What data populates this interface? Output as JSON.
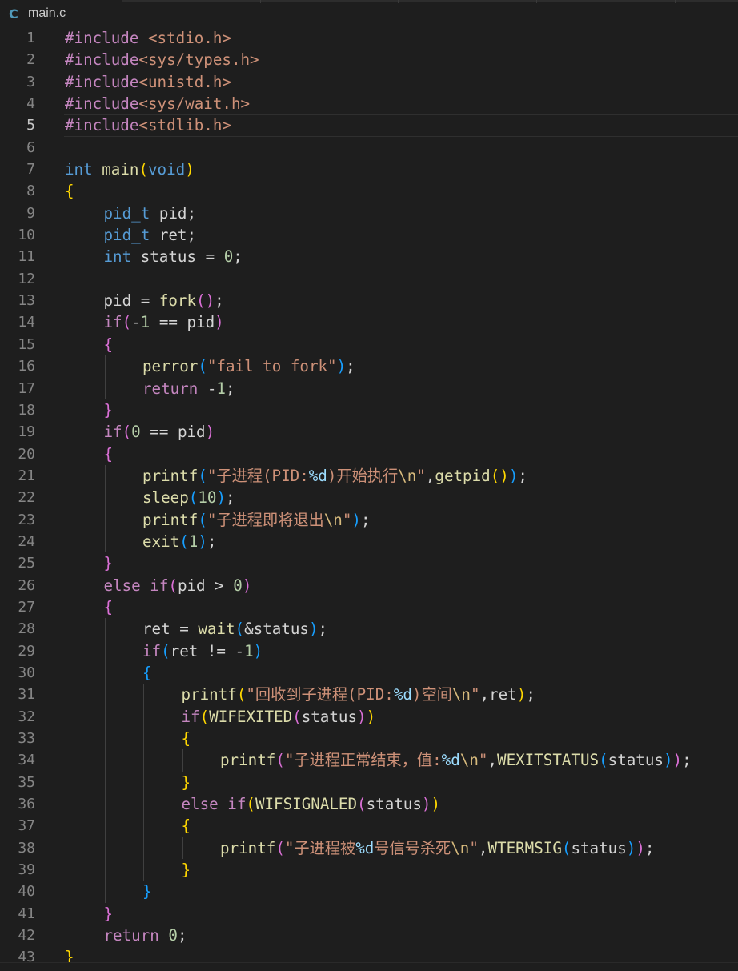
{
  "tab": {
    "icon": "C",
    "icon_name": "c-file-icon",
    "filename": "main.c"
  },
  "colors": {
    "background": "#1e1e1e",
    "preprocessor": "#c586c0",
    "keyword": "#569cd6",
    "control": "#c586c0",
    "function": "#dcdcaa",
    "string": "#ce9178",
    "number": "#b5cea8",
    "bracket_1": "#ffd700",
    "bracket_2": "#da70d6",
    "bracket_3": "#179fff"
  },
  "editor": {
    "current_line": 5,
    "lines": [
      {
        "n": "1",
        "indent": 0,
        "tokens": [
          [
            "pp",
            "#include"
          ],
          [
            "txt",
            " "
          ],
          [
            "inc",
            "<stdio.h>"
          ]
        ]
      },
      {
        "n": "2",
        "indent": 0,
        "tokens": [
          [
            "pp",
            "#include"
          ],
          [
            "inc",
            "<sys/types.h>"
          ]
        ]
      },
      {
        "n": "3",
        "indent": 0,
        "tokens": [
          [
            "pp",
            "#include"
          ],
          [
            "inc",
            "<unistd.h>"
          ]
        ]
      },
      {
        "n": "4",
        "indent": 0,
        "tokens": [
          [
            "pp",
            "#include"
          ],
          [
            "inc",
            "<sys/wait.h>"
          ]
        ]
      },
      {
        "n": "5",
        "indent": 0,
        "tokens": [
          [
            "pp",
            "#include"
          ],
          [
            "inc",
            "<stdlib.h>"
          ]
        ]
      },
      {
        "n": "6",
        "indent": 0,
        "tokens": []
      },
      {
        "n": "7",
        "indent": 0,
        "tokens": [
          [
            "kw",
            "int"
          ],
          [
            "txt",
            " "
          ],
          [
            "fn",
            "main"
          ],
          [
            "b1",
            "("
          ],
          [
            "kw",
            "void"
          ],
          [
            "b1",
            ")"
          ]
        ]
      },
      {
        "n": "8",
        "indent": 0,
        "tokens": [
          [
            "b1",
            "{"
          ]
        ]
      },
      {
        "n": "9",
        "indent": 1,
        "tokens": [
          [
            "kw",
            "pid_t"
          ],
          [
            "txt",
            " pid;"
          ]
        ]
      },
      {
        "n": "10",
        "indent": 1,
        "tokens": [
          [
            "kw",
            "pid_t"
          ],
          [
            "txt",
            " ret;"
          ]
        ]
      },
      {
        "n": "11",
        "indent": 1,
        "tokens": [
          [
            "kw",
            "int"
          ],
          [
            "txt",
            " status = "
          ],
          [
            "num",
            "0"
          ],
          [
            "txt",
            ";"
          ]
        ]
      },
      {
        "n": "12",
        "indent": 1,
        "tokens": []
      },
      {
        "n": "13",
        "indent": 1,
        "tokens": [
          [
            "txt",
            "pid = "
          ],
          [
            "fn",
            "fork"
          ],
          [
            "b2",
            "()"
          ],
          [
            "txt",
            ";"
          ]
        ]
      },
      {
        "n": "14",
        "indent": 1,
        "tokens": [
          [
            "ctl",
            "if"
          ],
          [
            "b2",
            "("
          ],
          [
            "txt",
            "-"
          ],
          [
            "num",
            "1"
          ],
          [
            "txt",
            " == pid"
          ],
          [
            "b2",
            ")"
          ]
        ]
      },
      {
        "n": "15",
        "indent": 1,
        "tokens": [
          [
            "b2",
            "{"
          ]
        ]
      },
      {
        "n": "16",
        "indent": 2,
        "tokens": [
          [
            "fn",
            "perror"
          ],
          [
            "b3",
            "("
          ],
          [
            "str",
            "\"fail to fork\""
          ],
          [
            "b3",
            ")"
          ],
          [
            "txt",
            ";"
          ]
        ]
      },
      {
        "n": "17",
        "indent": 2,
        "tokens": [
          [
            "ctl",
            "return"
          ],
          [
            "txt",
            " -"
          ],
          [
            "num",
            "1"
          ],
          [
            "txt",
            ";"
          ]
        ]
      },
      {
        "n": "18",
        "indent": 1,
        "tokens": [
          [
            "b2",
            "}"
          ]
        ]
      },
      {
        "n": "19",
        "indent": 1,
        "tokens": [
          [
            "ctl",
            "if"
          ],
          [
            "b2",
            "("
          ],
          [
            "num",
            "0"
          ],
          [
            "txt",
            " == pid"
          ],
          [
            "b2",
            ")"
          ]
        ]
      },
      {
        "n": "20",
        "indent": 1,
        "tokens": [
          [
            "b2",
            "{"
          ]
        ]
      },
      {
        "n": "21",
        "indent": 2,
        "tokens": [
          [
            "fn",
            "printf"
          ],
          [
            "b3",
            "("
          ],
          [
            "str",
            "\"子进程(PID:"
          ],
          [
            "fmt",
            "%d"
          ],
          [
            "str",
            ")开始执行"
          ],
          [
            "esc",
            "\\n"
          ],
          [
            "str",
            "\""
          ],
          [
            "txt",
            ","
          ],
          [
            "fn",
            "getpid"
          ],
          [
            "b1",
            "()"
          ],
          [
            "b3",
            ")"
          ],
          [
            "txt",
            ";"
          ]
        ]
      },
      {
        "n": "22",
        "indent": 2,
        "tokens": [
          [
            "fn",
            "sleep"
          ],
          [
            "b3",
            "("
          ],
          [
            "num",
            "10"
          ],
          [
            "b3",
            ")"
          ],
          [
            "txt",
            ";"
          ]
        ]
      },
      {
        "n": "23",
        "indent": 2,
        "tokens": [
          [
            "fn",
            "printf"
          ],
          [
            "b3",
            "("
          ],
          [
            "str",
            "\"子进程即将退出"
          ],
          [
            "esc",
            "\\n"
          ],
          [
            "str",
            "\""
          ],
          [
            "b3",
            ")"
          ],
          [
            "txt",
            ";"
          ]
        ]
      },
      {
        "n": "24",
        "indent": 2,
        "tokens": [
          [
            "fn",
            "exit"
          ],
          [
            "b3",
            "("
          ],
          [
            "num",
            "1"
          ],
          [
            "b3",
            ")"
          ],
          [
            "txt",
            ";"
          ]
        ]
      },
      {
        "n": "25",
        "indent": 1,
        "tokens": [
          [
            "b2",
            "}"
          ]
        ]
      },
      {
        "n": "26",
        "indent": 1,
        "tokens": [
          [
            "ctl",
            "else"
          ],
          [
            "txt",
            " "
          ],
          [
            "ctl",
            "if"
          ],
          [
            "b2",
            "("
          ],
          [
            "txt",
            "pid > "
          ],
          [
            "num",
            "0"
          ],
          [
            "b2",
            ")"
          ]
        ]
      },
      {
        "n": "27",
        "indent": 1,
        "tokens": [
          [
            "b2",
            "{"
          ]
        ]
      },
      {
        "n": "28",
        "indent": 2,
        "tokens": [
          [
            "txt",
            "ret = "
          ],
          [
            "fn",
            "wait"
          ],
          [
            "b3",
            "("
          ],
          [
            "txt",
            "&status"
          ],
          [
            "b3",
            ")"
          ],
          [
            "txt",
            ";"
          ]
        ]
      },
      {
        "n": "29",
        "indent": 2,
        "tokens": [
          [
            "ctl",
            "if"
          ],
          [
            "b3",
            "("
          ],
          [
            "txt",
            "ret != -"
          ],
          [
            "num",
            "1"
          ],
          [
            "b3",
            ")"
          ]
        ]
      },
      {
        "n": "30",
        "indent": 2,
        "tokens": [
          [
            "b3",
            "{"
          ]
        ]
      },
      {
        "n": "31",
        "indent": 3,
        "tokens": [
          [
            "fn",
            "printf"
          ],
          [
            "b1",
            "("
          ],
          [
            "str",
            "\"回收到子进程(PID:"
          ],
          [
            "fmt",
            "%d"
          ],
          [
            "str",
            ")空间"
          ],
          [
            "esc",
            "\\n"
          ],
          [
            "str",
            "\""
          ],
          [
            "txt",
            ",ret"
          ],
          [
            "b1",
            ")"
          ],
          [
            "txt",
            ";"
          ]
        ]
      },
      {
        "n": "32",
        "indent": 3,
        "tokens": [
          [
            "ctl",
            "if"
          ],
          [
            "b1",
            "("
          ],
          [
            "fn",
            "WIFEXITED"
          ],
          [
            "b2",
            "("
          ],
          [
            "txt",
            "status"
          ],
          [
            "b2",
            ")"
          ],
          [
            "b1",
            ")"
          ]
        ]
      },
      {
        "n": "33",
        "indent": 3,
        "tokens": [
          [
            "b1",
            "{"
          ]
        ]
      },
      {
        "n": "34",
        "indent": 4,
        "tokens": [
          [
            "fn",
            "printf"
          ],
          [
            "b2",
            "("
          ],
          [
            "str",
            "\"子进程正常结束，值:"
          ],
          [
            "fmt",
            "%d"
          ],
          [
            "esc",
            "\\n"
          ],
          [
            "str",
            "\""
          ],
          [
            "txt",
            ","
          ],
          [
            "fn",
            "WEXITSTATUS"
          ],
          [
            "b3",
            "("
          ],
          [
            "txt",
            "status"
          ],
          [
            "b3",
            ")"
          ],
          [
            "b2",
            ")"
          ],
          [
            "txt",
            ";"
          ]
        ]
      },
      {
        "n": "35",
        "indent": 3,
        "tokens": [
          [
            "b1",
            "}"
          ]
        ]
      },
      {
        "n": "36",
        "indent": 3,
        "tokens": [
          [
            "ctl",
            "else"
          ],
          [
            "txt",
            " "
          ],
          [
            "ctl",
            "if"
          ],
          [
            "b1",
            "("
          ],
          [
            "fn",
            "WIFSIGNALED"
          ],
          [
            "b2",
            "("
          ],
          [
            "txt",
            "status"
          ],
          [
            "b2",
            ")"
          ],
          [
            "b1",
            ")"
          ]
        ]
      },
      {
        "n": "37",
        "indent": 3,
        "tokens": [
          [
            "b1",
            "{"
          ]
        ]
      },
      {
        "n": "38",
        "indent": 4,
        "tokens": [
          [
            "fn",
            "printf"
          ],
          [
            "b2",
            "("
          ],
          [
            "str",
            "\"子进程被"
          ],
          [
            "fmt",
            "%d"
          ],
          [
            "str",
            "号信号杀死"
          ],
          [
            "esc",
            "\\n"
          ],
          [
            "str",
            "\""
          ],
          [
            "txt",
            ","
          ],
          [
            "fn",
            "WTERMSIG"
          ],
          [
            "b3",
            "("
          ],
          [
            "txt",
            "status"
          ],
          [
            "b3",
            ")"
          ],
          [
            "b2",
            ")"
          ],
          [
            "txt",
            ";"
          ]
        ]
      },
      {
        "n": "39",
        "indent": 3,
        "tokens": [
          [
            "b1",
            "}"
          ]
        ]
      },
      {
        "n": "40",
        "indent": 2,
        "tokens": [
          [
            "b3",
            "}"
          ]
        ]
      },
      {
        "n": "41",
        "indent": 1,
        "tokens": [
          [
            "b2",
            "}"
          ]
        ]
      },
      {
        "n": "42",
        "indent": 1,
        "tokens": [
          [
            "ctl",
            "return"
          ],
          [
            "txt",
            " "
          ],
          [
            "num",
            "0"
          ],
          [
            "txt",
            ";"
          ]
        ]
      },
      {
        "n": "43",
        "indent": 0,
        "tokens": [
          [
            "b1",
            "}"
          ]
        ]
      }
    ]
  }
}
